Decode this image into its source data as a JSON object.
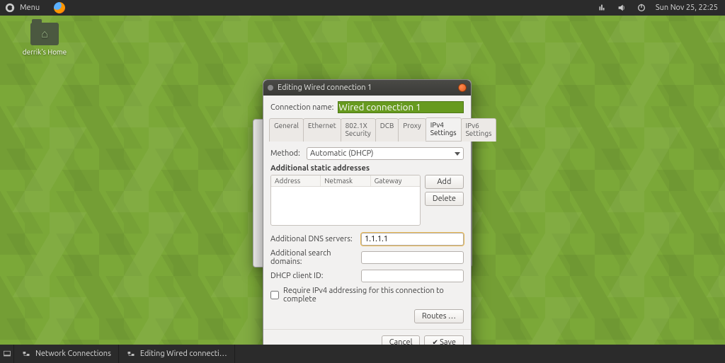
{
  "top_panel": {
    "menu_label": "Menu",
    "clock": "Sun Nov 25, 22:25"
  },
  "desktop": {
    "home_icon_label": "derrik's Home"
  },
  "bottom_panel": {
    "task1": "Network Connections",
    "task2": "Editing Wired connecti…"
  },
  "dialog": {
    "title": "Editing Wired connection 1",
    "conn_name_label": "Connection name:",
    "conn_name_value": "Wired connection 1",
    "tabs": {
      "general": "General",
      "ethernet": "Ethernet",
      "security": "802.1X Security",
      "dcb": "DCB",
      "proxy": "Proxy",
      "ipv4": "IPv4 Settings",
      "ipv6": "IPv6 Settings"
    },
    "method_label": "Method:",
    "method_value": "Automatic (DHCP)",
    "addresses_title": "Additional static addresses",
    "col_address": "Address",
    "col_netmask": "Netmask",
    "col_gateway": "Gateway",
    "add_btn": "Add",
    "delete_btn": "Delete",
    "dns_label": "Additional DNS servers:",
    "dns_value": "1.1.1.1",
    "search_label": "Additional search domains:",
    "search_value": "",
    "dhcp_label": "DHCP client ID:",
    "dhcp_value": "",
    "require_label": "Require IPv4 addressing for this connection to complete",
    "routes_btn": "Routes …",
    "cancel_btn": "Cancel",
    "save_btn": "Save"
  }
}
